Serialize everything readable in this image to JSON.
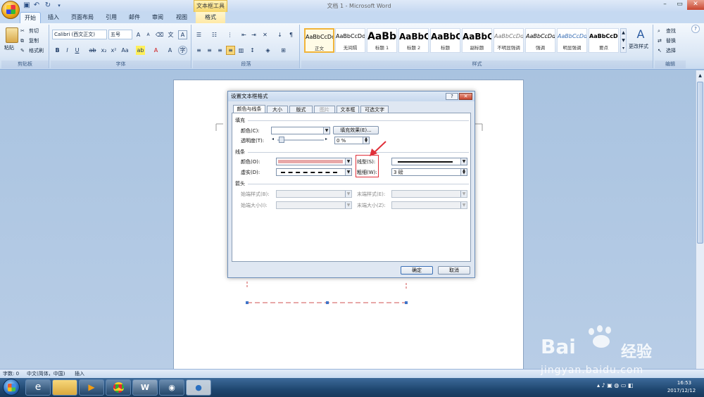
{
  "window": {
    "title": "文档 1 - Microsoft Word",
    "context_tab_header": "文本框工具"
  },
  "tabs": [
    "开始",
    "插入",
    "页面布局",
    "引用",
    "邮件",
    "审阅",
    "视图",
    "格式"
  ],
  "ribbon": {
    "clipboard": {
      "paste": "粘贴",
      "cut": "剪切",
      "copy": "复制",
      "format_painter": "格式刷",
      "label": "剪贴板"
    },
    "font": {
      "name": "Calibri (西文正文)",
      "size": "五号",
      "label": "字体"
    },
    "paragraph": {
      "label": "段落"
    },
    "styles": {
      "items": [
        "正文",
        "无间隔",
        "标题 1",
        "标题 2",
        "标题",
        "副标题",
        "不明显强调",
        "强调",
        "明显强调",
        "要点"
      ],
      "previews": [
        "AaBbCcDd",
        "AaBbCcDd",
        "AaBb",
        "AaBbC",
        "AaBbC",
        "AaBbC",
        "AaBbCcDd",
        "AaBbCcDd",
        "AaBbCcDd",
        "AaBbCcDd"
      ],
      "change": "更改样式",
      "label": "样式"
    },
    "editing": {
      "find": "查找",
      "replace": "替换",
      "select": "选择",
      "label": "编辑"
    }
  },
  "dialog": {
    "title": "设置文本框格式",
    "tabs": [
      "颜色与线条",
      "大小",
      "版式",
      "图片",
      "文本框",
      "可选文字"
    ],
    "fill": {
      "section": "填充",
      "color_label": "颜色(C):",
      "fill_effects": "填充效果(E)...",
      "transparency_label": "透明度(T):",
      "transparency_value": "0 %"
    },
    "line": {
      "section": "线条",
      "color_label": "颜色(O):",
      "dash_label": "虚实(D):",
      "style_label": "线型(S):",
      "weight_label": "粗细(W):",
      "weight_value": "3 磅",
      "line_color": "#e8a8a8"
    },
    "arrows": {
      "section": "箭头",
      "begin_style": "始端样式(B):",
      "begin_size": "始端大小(I):",
      "end_style": "末端样式(E):",
      "end_size": "末端大小(Z):"
    },
    "ok": "确定",
    "cancel": "取消"
  },
  "status": {
    "words": "字数: 0",
    "language": "中文(简体，中国)",
    "mode": "插入"
  },
  "tray": {
    "time": "16:53",
    "date": "2017/12/12"
  },
  "watermark": {
    "brand": "Bai",
    "brand2": "经验",
    "url": "jingyan.baidu.com"
  }
}
